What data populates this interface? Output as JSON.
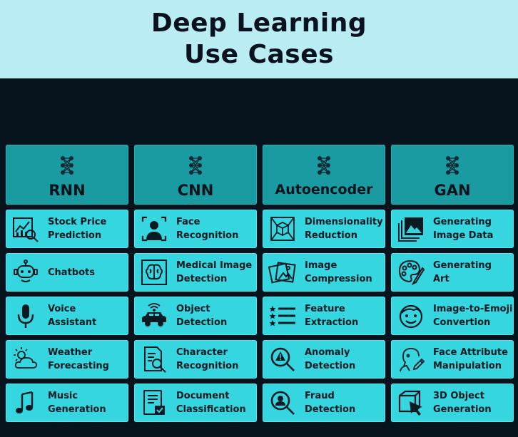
{
  "title": {
    "line1": "Deep Learning",
    "line2": "Use Cases"
  },
  "colors": {
    "title_bg": "#b9ecf3",
    "page_bg": "#07131d",
    "header_bg": "#1a9ba1",
    "cell_bg": "#35d6df",
    "text": "#0a1a22"
  },
  "columns": [
    {
      "header": "RNN",
      "icon": "neural-network-icon",
      "items": [
        {
          "label": "Stock Price\nPrediction",
          "icon": "stock-chart-magnifier-icon"
        },
        {
          "label": "Chatbots",
          "icon": "robot-icon"
        },
        {
          "label": "Voice\nAssistant",
          "icon": "microphone-icon"
        },
        {
          "label": "Weather\nForecasting",
          "icon": "sun-cloud-icon"
        },
        {
          "label": "Music\nGeneration",
          "icon": "music-note-icon"
        }
      ]
    },
    {
      "header": "CNN",
      "icon": "neural-network-icon",
      "items": [
        {
          "label": "Face\nRecognition",
          "icon": "face-scan-icon"
        },
        {
          "label": "Medical Image\nDetection",
          "icon": "brain-scan-icon"
        },
        {
          "label": "Object\nDetection",
          "icon": "car-sensor-icon"
        },
        {
          "label": "Character\nRecognition",
          "icon": "document-search-icon"
        },
        {
          "label": "Document\nClassification",
          "icon": "document-check-icon"
        }
      ]
    },
    {
      "header": "Autoencoder",
      "icon": "neural-network-icon",
      "items": [
        {
          "label": "Dimensionality\nReduction",
          "icon": "cube-frame-icon"
        },
        {
          "label": "Image\nCompression",
          "icon": "photo-stack-icon"
        },
        {
          "label": "Feature\nExtraction",
          "icon": "star-list-icon"
        },
        {
          "label": "Anomaly\nDetection",
          "icon": "warning-magnifier-icon"
        },
        {
          "label": "Fraud\nDetection",
          "icon": "fraud-magnifier-icon"
        }
      ]
    },
    {
      "header": "GAN",
      "icon": "neural-network-icon",
      "items": [
        {
          "label": "Generating\nImage Data",
          "icon": "image-gallery-icon"
        },
        {
          "label": "Generating\nArt",
          "icon": "palette-icon"
        },
        {
          "label": "Image-to-Emoji\nConvertion",
          "icon": "emoji-face-icon"
        },
        {
          "label": "Face Attribute\nManipulation",
          "icon": "face-edit-icon"
        },
        {
          "label": "3D Object\nGeneration",
          "icon": "3d-cube-cursor-icon"
        }
      ]
    }
  ]
}
